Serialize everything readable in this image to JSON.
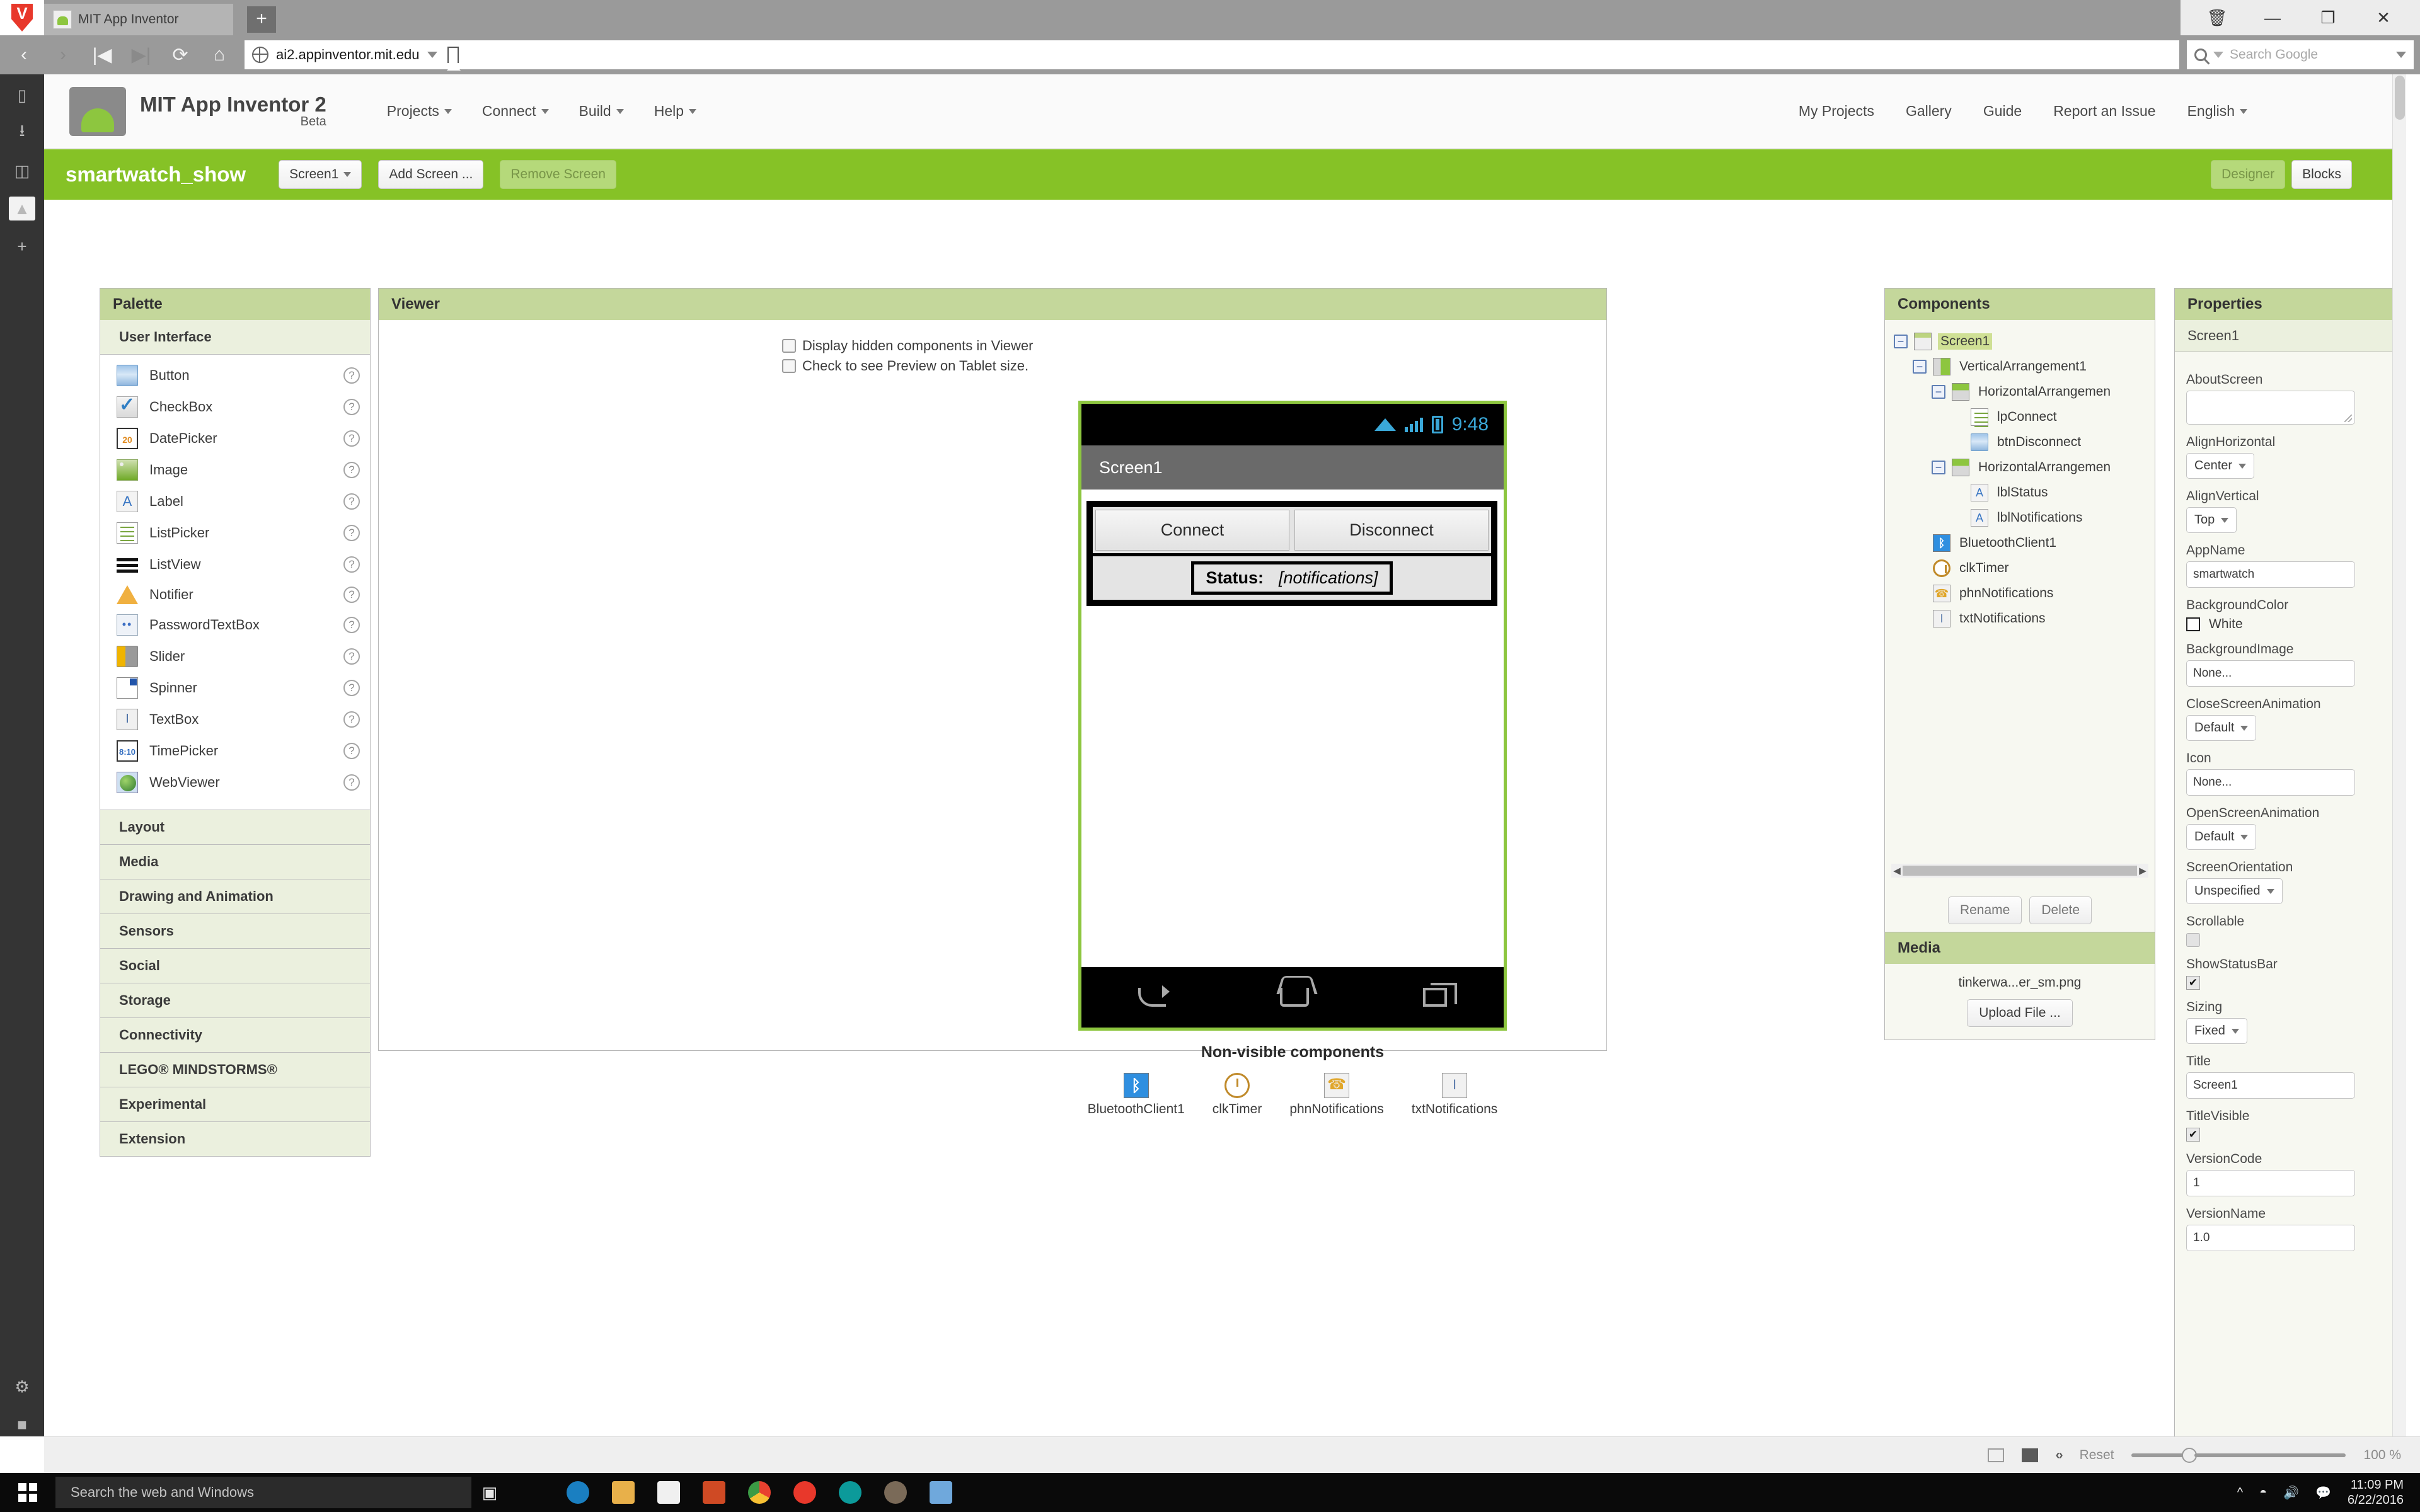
{
  "browser": {
    "tab_title": "MIT App Inventor",
    "new_tab_label": "+",
    "url": "ai2.appinventor.mit.edu",
    "search_placeholder": "Search Google",
    "window_controls": {
      "trash": "🗑",
      "minimize": "—",
      "maximize": "❐",
      "close": "✕"
    },
    "nav": {
      "back": "‹",
      "forward": "›",
      "rewind": "|◀",
      "fastforward": "▶|",
      "reload": "⟳",
      "home": "⌂"
    },
    "status_zoom": {
      "reset_label": "Reset",
      "zoom_level": "100 %"
    }
  },
  "header": {
    "title_line1": "MIT App Inventor 2",
    "title_line2": "Beta",
    "menu": [
      "Projects",
      "Connect",
      "Build",
      "Help"
    ],
    "account_links": [
      "My Projects",
      "Gallery",
      "Guide",
      "Report an Issue",
      "English"
    ]
  },
  "project_bar": {
    "project_name": "smartwatch_show",
    "screen_selector": "Screen1",
    "add_screen": "Add Screen ...",
    "remove_screen": "Remove Screen",
    "designer_tab": "Designer",
    "blocks_tab": "Blocks"
  },
  "palette": {
    "title": "Palette",
    "open_category": "User Interface",
    "items": [
      {
        "label": "Button",
        "icon": "button-icon"
      },
      {
        "label": "CheckBox",
        "icon": "checkbox-icon"
      },
      {
        "label": "DatePicker",
        "icon": "datepicker-icon"
      },
      {
        "label": "Image",
        "icon": "image-icon"
      },
      {
        "label": "Label",
        "icon": "label-icon"
      },
      {
        "label": "ListPicker",
        "icon": "listpicker-icon"
      },
      {
        "label": "ListView",
        "icon": "listview-icon"
      },
      {
        "label": "Notifier",
        "icon": "notifier-icon"
      },
      {
        "label": "PasswordTextBox",
        "icon": "password-icon"
      },
      {
        "label": "Slider",
        "icon": "slider-icon"
      },
      {
        "label": "Spinner",
        "icon": "spinner-icon"
      },
      {
        "label": "TextBox",
        "icon": "textbox-icon"
      },
      {
        "label": "TimePicker",
        "icon": "timepicker-icon"
      },
      {
        "label": "WebViewer",
        "icon": "webviewer-icon"
      }
    ],
    "help_glyph": "?",
    "categories": [
      "Layout",
      "Media",
      "Drawing and Animation",
      "Sensors",
      "Social",
      "Storage",
      "Connectivity",
      "LEGO® MINDSTORMS®",
      "Experimental",
      "Extension"
    ]
  },
  "viewer": {
    "title": "Viewer",
    "checkbox_hidden": "Display hidden components in Viewer",
    "checkbox_tablet": "Check to see Preview on Tablet size.",
    "phone": {
      "status_time": "9:48",
      "screen_title": "Screen1",
      "btn_connect": "Connect",
      "btn_disconnect": "Disconnect",
      "status_label": "Status:",
      "status_value": "[notifications]"
    },
    "nonvisible_title": "Non-visible components",
    "nonvisible": [
      {
        "label": "BluetoothClient1",
        "icon": "bluetooth-icon"
      },
      {
        "label": "clkTimer",
        "icon": "clock-icon"
      },
      {
        "label": "phnNotifications",
        "icon": "phone-icon"
      },
      {
        "label": "txtNotifications",
        "icon": "texting-icon"
      }
    ]
  },
  "components": {
    "title": "Components",
    "tree": [
      {
        "label": "Screen1",
        "depth": 0,
        "expander": "−",
        "icon": "screen-icon",
        "selected": true
      },
      {
        "label": "VerticalArrangement1",
        "depth": 1,
        "expander": "−",
        "icon": "vertical-arrangement-icon",
        "selected": false
      },
      {
        "label": "HorizontalArrangemen",
        "depth": 2,
        "expander": "−",
        "icon": "horizontal-arrangement-icon",
        "selected": false
      },
      {
        "label": "lpConnect",
        "depth": 3,
        "expander": "",
        "icon": "listpicker-icon",
        "selected": false
      },
      {
        "label": "btnDisconnect",
        "depth": 3,
        "expander": "",
        "icon": "button-icon",
        "selected": false
      },
      {
        "label": "HorizontalArrangemen",
        "depth": 2,
        "expander": "−",
        "icon": "horizontal-arrangement-icon",
        "selected": false
      },
      {
        "label": "lblStatus",
        "depth": 3,
        "expander": "",
        "icon": "label-icon",
        "selected": false
      },
      {
        "label": "lblNotifications",
        "depth": 3,
        "expander": "",
        "icon": "label-icon",
        "selected": false
      },
      {
        "label": "BluetoothClient1",
        "depth": 1,
        "expander": "",
        "icon": "bluetooth-icon",
        "selected": false
      },
      {
        "label": "clkTimer",
        "depth": 1,
        "expander": "",
        "icon": "clock-icon",
        "selected": false
      },
      {
        "label": "phnNotifications",
        "depth": 1,
        "expander": "",
        "icon": "phone-icon",
        "selected": false
      },
      {
        "label": "txtNotifications",
        "depth": 1,
        "expander": "",
        "icon": "texting-icon",
        "selected": false
      }
    ],
    "rename_label": "Rename",
    "delete_label": "Delete"
  },
  "media": {
    "title": "Media",
    "file_name": "tinkerwa...er_sm.png",
    "upload_label": "Upload File ..."
  },
  "properties": {
    "title": "Properties",
    "selected_component": "Screen1",
    "rows": [
      {
        "label": "AboutScreen",
        "type": "textarea",
        "value": ""
      },
      {
        "label": "AlignHorizontal",
        "type": "select",
        "value": "Center"
      },
      {
        "label": "AlignVertical",
        "type": "select",
        "value": "Top"
      },
      {
        "label": "AppName",
        "type": "text",
        "value": "smartwatch"
      },
      {
        "label": "BackgroundColor",
        "type": "color",
        "value": "White"
      },
      {
        "label": "BackgroundImage",
        "type": "text",
        "value": "None..."
      },
      {
        "label": "CloseScreenAnimation",
        "type": "select",
        "value": "Default"
      },
      {
        "label": "Icon",
        "type": "text",
        "value": "None..."
      },
      {
        "label": "OpenScreenAnimation",
        "type": "select",
        "value": "Default"
      },
      {
        "label": "ScreenOrientation",
        "type": "select",
        "value": "Unspecified"
      },
      {
        "label": "Scrollable",
        "type": "checkbox-off",
        "value": ""
      },
      {
        "label": "ShowStatusBar",
        "type": "checkbox-on",
        "value": "✔"
      },
      {
        "label": "Sizing",
        "type": "select",
        "value": "Fixed"
      },
      {
        "label": "Title",
        "type": "text",
        "value": "Screen1"
      },
      {
        "label": "TitleVisible",
        "type": "checkbox-on",
        "value": "✔"
      },
      {
        "label": "VersionCode",
        "type": "text",
        "value": "1"
      },
      {
        "label": "VersionName",
        "type": "text",
        "value": "1.0"
      }
    ]
  },
  "taskbar": {
    "search_placeholder": "Search the web and Windows",
    "clock_time": "11:09 PM",
    "clock_date": "6/22/2016"
  }
}
